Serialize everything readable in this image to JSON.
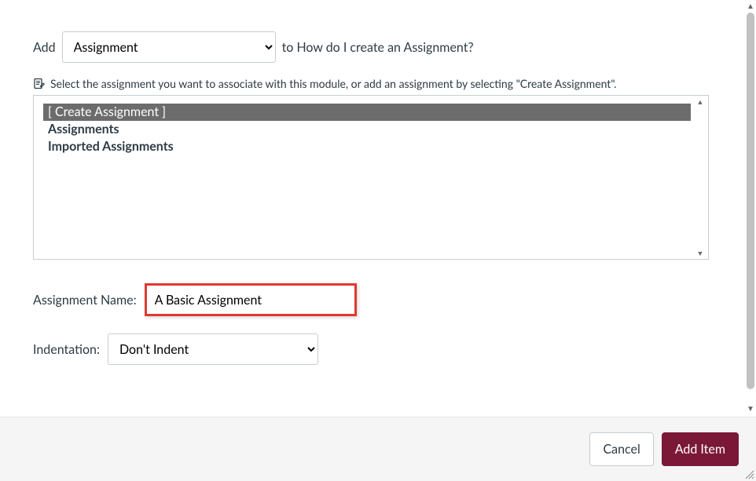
{
  "header": {
    "add_label": "Add",
    "type_select": "Assignment",
    "suffix_label": "to How do I create an Assignment?"
  },
  "helper": {
    "text": "Select the assignment you want to associate with this module, or add an assignment by selecting \"Create Assignment\"."
  },
  "listbox": {
    "create_label": "[ Create Assignment ]",
    "groups": [
      "Assignments",
      "Imported Assignments"
    ]
  },
  "fields": {
    "name_label": "Assignment Name:",
    "name_value": "A Basic Assignment",
    "indent_label": "Indentation:",
    "indent_value": "Don't Indent"
  },
  "footer": {
    "cancel_label": "Cancel",
    "add_label": "Add Item"
  }
}
